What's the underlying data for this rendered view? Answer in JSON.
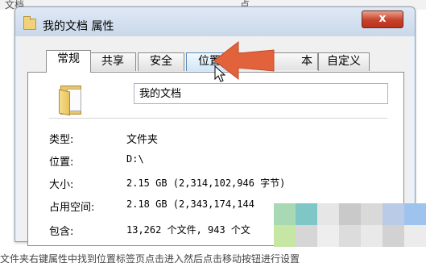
{
  "background_strip": {
    "left_text": "文档",
    "right_text": "点"
  },
  "window": {
    "title": "我的文档 属性",
    "close_label": "x"
  },
  "tabs": [
    {
      "label": "常规",
      "active": true
    },
    {
      "label": "共享",
      "active": false
    },
    {
      "label": "安全",
      "active": false
    },
    {
      "label": "位置",
      "active": false,
      "hovered": true
    },
    {
      "label": "本",
      "active": false
    },
    {
      "label": "自定义",
      "active": false
    }
  ],
  "general": {
    "name_value": "我的文档",
    "properties": [
      {
        "label": "类型:",
        "value": "文件夹"
      },
      {
        "label": "位置:",
        "value": "D:\\"
      },
      {
        "label": "大小:",
        "value": "2.15 GB (2,314,102,946 字节)"
      },
      {
        "label": "占用空间:",
        "value": "2.18 GB (2,343,174,144"
      },
      {
        "label": "包含:",
        "value": "13,262 个文件, 943 个文"
      }
    ]
  },
  "overlay": {
    "arrow_color": "#e2623c",
    "hover_accent": "#5a8cba"
  },
  "bottom_caption": "文件夹右键属性中找到位置标签页点击进入然后点击移动按钮进行设置"
}
